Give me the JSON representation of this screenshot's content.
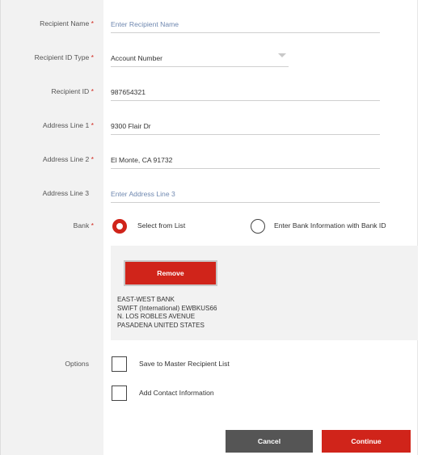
{
  "fields": {
    "recipient_name": {
      "label": "Recipient Name",
      "placeholder": "Enter Recipient Name",
      "value": ""
    },
    "recipient_id_type": {
      "label": "Recipient ID Type",
      "value": "Account Number"
    },
    "recipient_id": {
      "label": "Recipient ID",
      "value": "987654321"
    },
    "address1": {
      "label": "Address Line 1",
      "value": "9300 Flair Dr"
    },
    "address2": {
      "label": "Address Line 2",
      "value": "El Monte, CA 91732"
    },
    "address3": {
      "label": "Address Line 3",
      "placeholder": "Enter Address Line 3",
      "value": ""
    }
  },
  "required_marker": "*",
  "bank": {
    "label": "Bank",
    "option_list": "Select from List",
    "option_info": "Enter Bank Information with Bank ID",
    "selected": "Select from List",
    "remove_label": "Remove",
    "details": [
      "EAST-WEST BANK",
      "SWIFT (International) EWBKUS66",
      "N. LOS ROBLES AVENUE",
      "PASADENA UNITED STATES"
    ]
  },
  "options": {
    "label": "Options",
    "save_master": "Save to Master Recipient List",
    "add_contact": "Add Contact Information",
    "save_master_checked": false,
    "add_contact_checked": false
  },
  "actions": {
    "cancel": "Cancel",
    "continue": "Continue"
  },
  "colors": {
    "accent": "#d0241a",
    "secondary": "#555555",
    "placeholder": "#6f88b0"
  }
}
